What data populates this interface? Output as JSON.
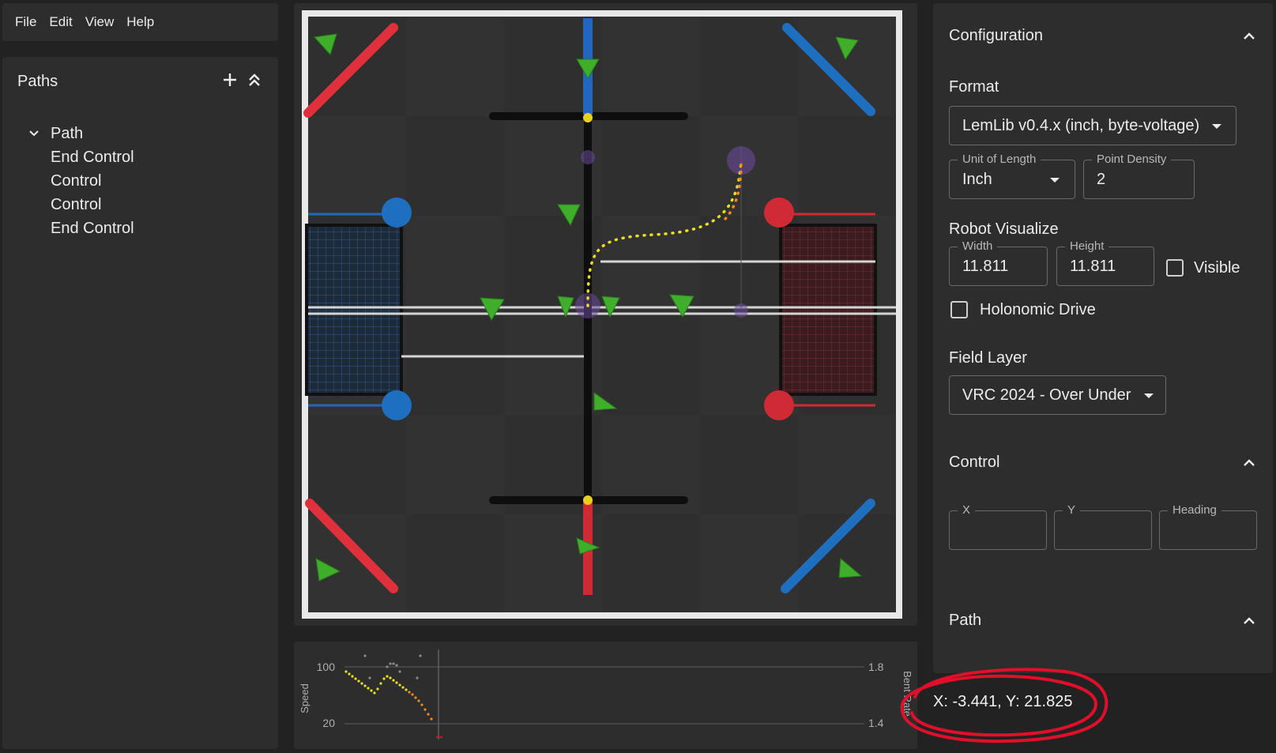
{
  "menu": [
    "File",
    "Edit",
    "View",
    "Help"
  ],
  "paths_panel": {
    "title": "Paths",
    "tree": {
      "path_label": "Path",
      "children": [
        "End Control",
        "Control",
        "Control",
        "End Control"
      ]
    }
  },
  "config": {
    "title": "Configuration",
    "format_label": "Format",
    "format_value": "LemLib v0.4.x (inch, byte-voltage)",
    "unit_label": "Unit of Length",
    "unit_value": "Inch",
    "density_label": "Point Density",
    "density_value": "2",
    "robot_label": "Robot Visualize",
    "width_label": "Width",
    "width_value": "11.811",
    "height_label": "Height",
    "height_value": "11.811",
    "visible_label": "Visible",
    "holonomic_label": "Holonomic Drive",
    "field_layer_label": "Field Layer",
    "field_layer_value": "VRC 2024 - Over Under",
    "control_title": "Control",
    "x_label": "X",
    "y_label": "Y",
    "heading_label": "Heading",
    "path_title": "Path"
  },
  "graph": {
    "speed_label": "Speed",
    "bent_label": "Bent Rate",
    "left_ticks": [
      "100",
      "20"
    ],
    "right_ticks": [
      "1.8",
      "1.4"
    ]
  },
  "status": "X: -3.441, Y: 21.825",
  "colors": {
    "panel": "#2d2d2d",
    "background": "#222222",
    "red_alliance": "#e0303c",
    "blue_alliance": "#1f6fc0",
    "triball": "#3fae2a",
    "path": "#e8e020",
    "annotation": "#e0102a"
  }
}
